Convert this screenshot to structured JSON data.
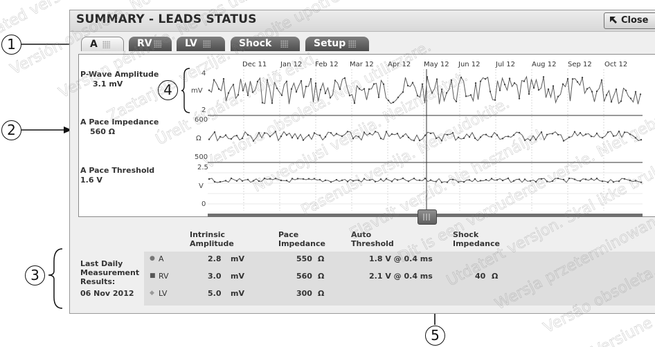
{
  "window": {
    "title": "SUMMARY - LEADS STATUS",
    "close_label": "Close"
  },
  "tabs": [
    {
      "label": "A",
      "active": true
    },
    {
      "label": "RV",
      "active": false
    },
    {
      "label": "LV",
      "active": false
    },
    {
      "label": "Shock",
      "active": false
    },
    {
      "label": "Setup",
      "active": false
    }
  ],
  "timeline": {
    "months": [
      "Dec 11",
      "Jan 12",
      "Feb 12",
      "Mar 12",
      "Apr 12",
      "May 12",
      "Jun 12",
      "Jul 12",
      "Aug 12",
      "Sep 12",
      "Oct 12"
    ]
  },
  "charts": [
    {
      "name": "P-Wave Amplitude",
      "value": "3.1 mV",
      "unit": "mV",
      "ticks": [
        "4",
        "2"
      ]
    },
    {
      "name": "A Pace Impedance",
      "value": "560 Ω",
      "unit": "Ω",
      "ticks": [
        "600",
        "500"
      ]
    },
    {
      "name": "A Pace Threshold",
      "value": "1.6 V",
      "unit": "V",
      "ticks": [
        "2.5",
        "0"
      ]
    }
  ],
  "measurements": {
    "row_label": [
      "Last Daily",
      "Measurement",
      "Results:"
    ],
    "date": "06 Nov 2012",
    "columns": [
      {
        "line1": "Intrinsic",
        "line2": "Amplitude"
      },
      {
        "line1": "Pace",
        "line2": "Impedance"
      },
      {
        "line1": "Auto",
        "line2": "Threshold"
      },
      {
        "line1": "Shock",
        "line2": "Impedance"
      }
    ],
    "rows": [
      {
        "symbol": "●",
        "lead": "A",
        "amp_val": "2.8",
        "amp_unit": "mV",
        "imp_val": "550",
        "imp_unit": "Ω",
        "threshold": "1.8 V @ 0.4 ms",
        "shock_val": "",
        "shock_unit": ""
      },
      {
        "symbol": "■",
        "lead": "RV",
        "amp_val": "3.0",
        "amp_unit": "mV",
        "imp_val": "560",
        "imp_unit": "Ω",
        "threshold": "2.1 V @ 0.4 ms",
        "shock_val": "40",
        "shock_unit": "Ω"
      },
      {
        "symbol": "◆",
        "lead": "LV",
        "amp_val": "5.0",
        "amp_unit": "mV",
        "imp_val": "300",
        "imp_unit": "Ω",
        "threshold": "",
        "shock_val": "",
        "shock_unit": ""
      }
    ]
  },
  "callouts": [
    "1",
    "2",
    "3",
    "4",
    "5"
  ],
  "watermark_text": [
    "Aegunud versioon. Ärge kasutage.",
    "Outdated version. Do not use.",
    "Versión obsoleta. No utilizar.",
    "Version périmée. Ne pas utiliser.",
    "Zastarjela verzija. Nemojte upotrebljavati.",
    "Úrelt útgáfa. Notið ekki.",
    "Versione obsoleta. Non utilizzare.",
    "Novecojusi versija. Neizmantot.",
    "Pasenusi versija. Nenaudokite.",
    "Elavult verzió. Ne használja!",
    "Dit is een verouderde versie. Niet gebruiken.",
    "Utdatert versjon. Skal ikke brukes.",
    "Wersja przeterminowana. Nie używać.",
    "Versão obsoleta. Não utilize.",
    "Versiune expirată. A nu se utiliza."
  ],
  "colors": {
    "accent": "#666666",
    "trace": "#5a5a5a"
  }
}
